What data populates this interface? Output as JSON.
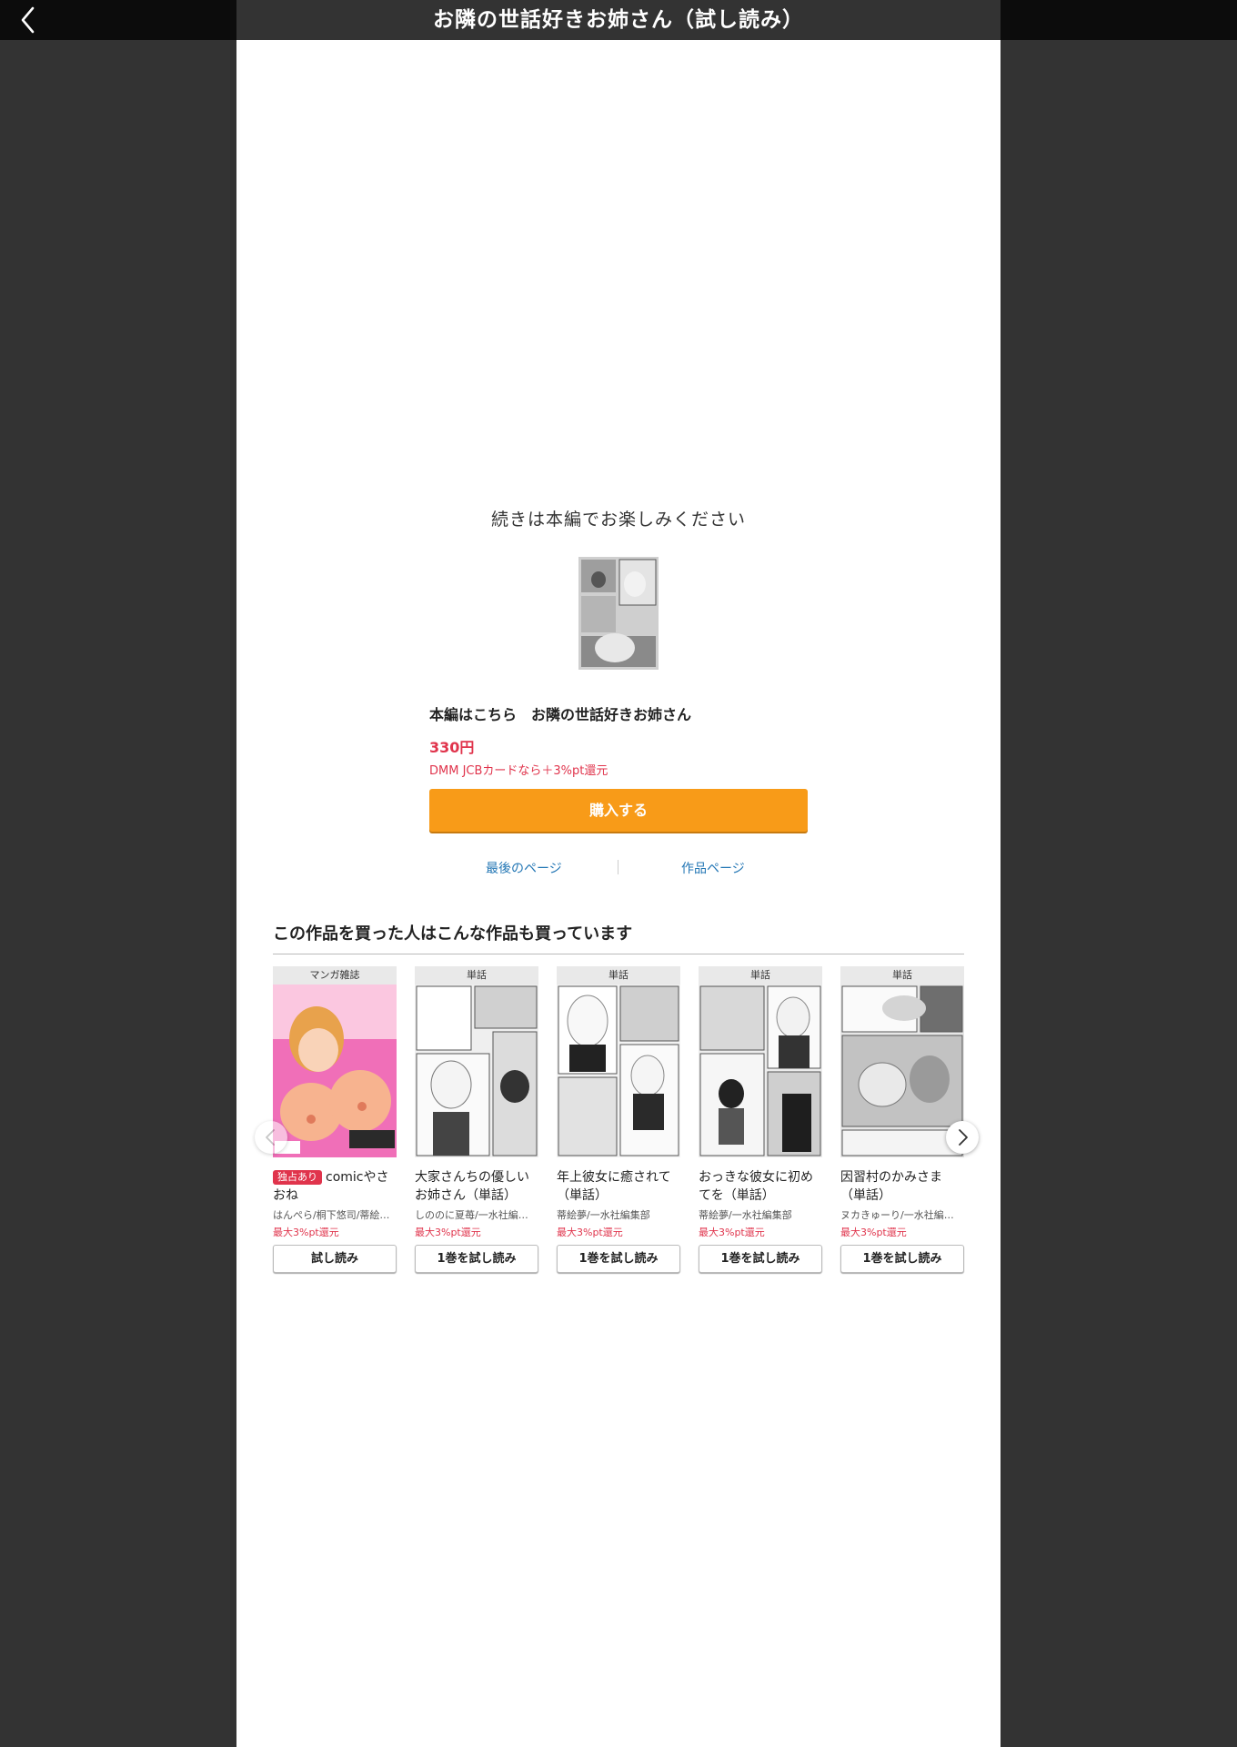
{
  "header": {
    "title": "お隣の世話好きお姉さん（試し読み）",
    "back_icon": "chevron-left-icon"
  },
  "end_panel": {
    "message": "続きは本編でお楽しみください",
    "main_title": "本編はこちら　お隣の世話好きお姉さん",
    "price": "330円",
    "card_note": "DMM JCBカードなら＋3%pt還元",
    "buy_label": "購入する",
    "last_page_link": "最後のページ",
    "work_page_link": "作品ページ"
  },
  "recommend": {
    "heading": "この作品を買った人はこんな作品も買っています",
    "items": [
      {
        "tag": "マンガ雑誌",
        "exclusive": "独占あり",
        "title": "comicやさおね",
        "author": "はんぺら/桐下悠司/蒂絵…",
        "points": "最大3%pt還元",
        "button": "試し読み"
      },
      {
        "tag": "単話",
        "exclusive": "",
        "title": "大家さんちの優しいお姉さん（単話）",
        "author": "しののに夏苺/一水社編…",
        "points": "最大3%pt還元",
        "button": "1巻を試し読み"
      },
      {
        "tag": "単話",
        "exclusive": "",
        "title": "年上彼女に癒されて（単話）",
        "author": "蒂絵夢/一水社編集部",
        "points": "最大3%pt還元",
        "button": "1巻を試し読み"
      },
      {
        "tag": "単話",
        "exclusive": "",
        "title": "おっきな彼女に初めてを（単話）",
        "author": "蒂絵夢/一水社編集部",
        "points": "最大3%pt還元",
        "button": "1巻を試し読み"
      },
      {
        "tag": "単話",
        "exclusive": "",
        "title": "因習村のかみさま（単話）",
        "author": "ヌカきゅーり/一水社編…",
        "points": "最大3%pt還元",
        "button": "1巻を試し読み"
      }
    ]
  },
  "colors": {
    "accent_orange": "#f89b18",
    "price_red": "#e0344c",
    "link_blue": "#2477b5",
    "frame": "#333333"
  }
}
